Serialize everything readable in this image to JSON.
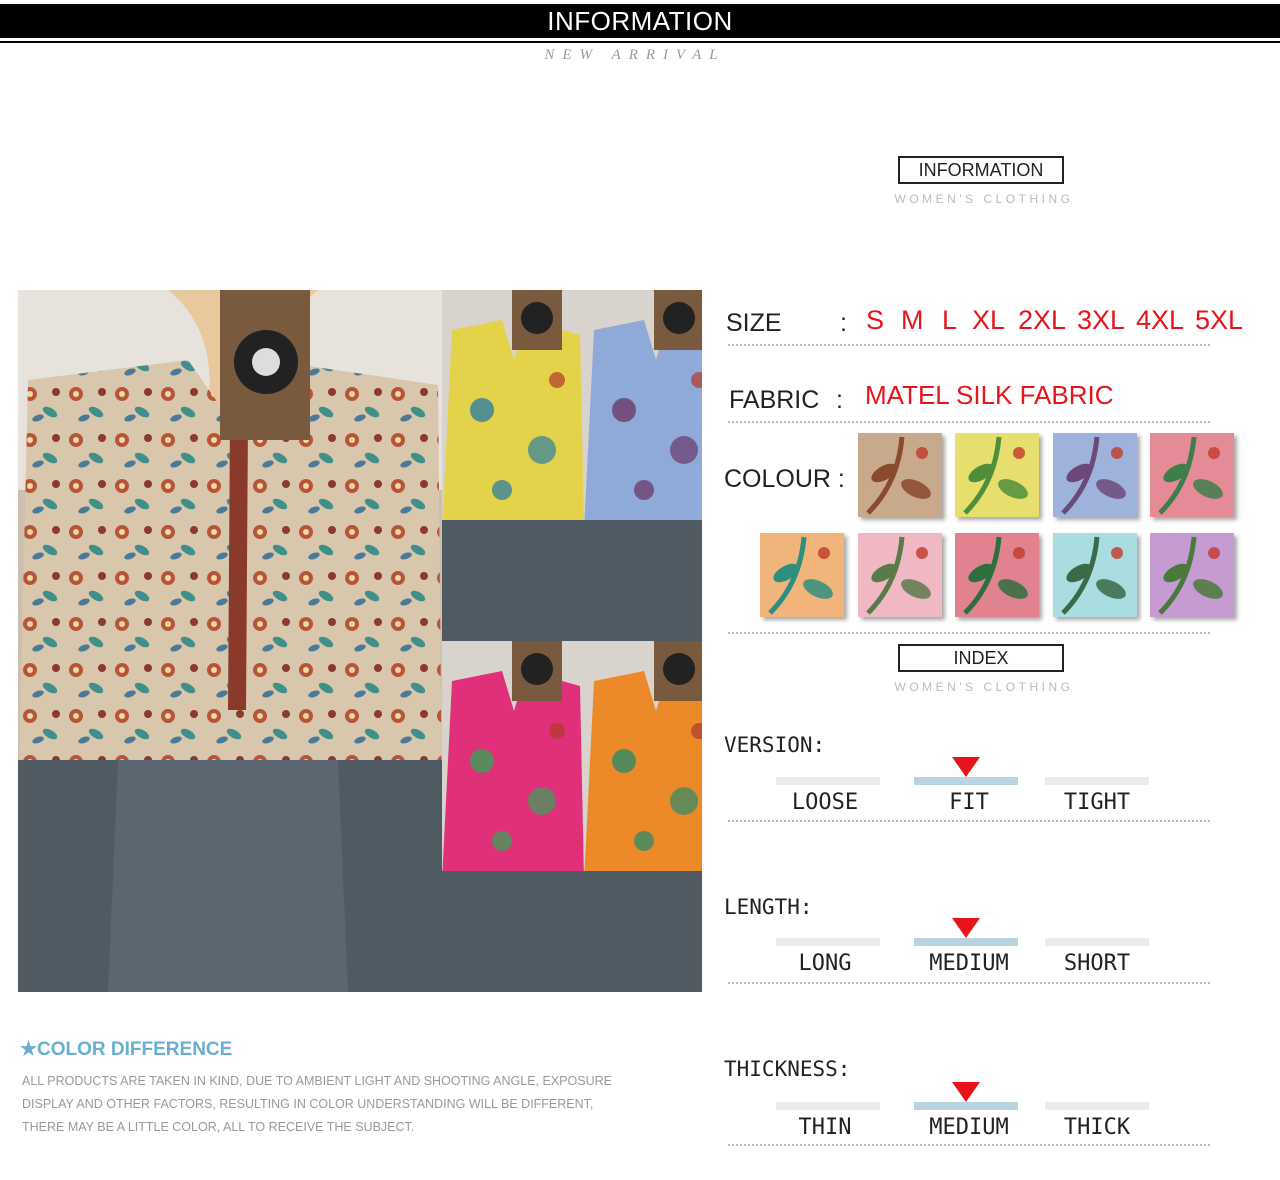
{
  "banner": {
    "title": "INFORMATION",
    "subtitle": "NEW ARRIVAL"
  },
  "info_header": {
    "title": "INFORMATION",
    "subtitle": "WOMEN'S CLOTHING"
  },
  "index_header": {
    "title": "INDEX",
    "subtitle": "WOMEN'S CLOTHING"
  },
  "specs": {
    "size": {
      "label": "SIZE",
      "colon": ":",
      "values": [
        "S",
        "M",
        "L",
        "XL",
        "2XL",
        "3XL",
        "4XL",
        "5XL"
      ]
    },
    "fabric": {
      "label": "FABRIC",
      "colon": ":",
      "value": "MATEL SILK FABRIC"
    },
    "colour": {
      "label": "COLOUR :",
      "swatches": [
        {
          "bg": "#c8a98c",
          "accent": "#8a4a2e"
        },
        {
          "bg": "#e6df6e",
          "accent": "#4f8f3a"
        },
        {
          "bg": "#9fb2dc",
          "accent": "#6b4a7a"
        },
        {
          "bg": "#e58a97",
          "accent": "#3e7e4a"
        },
        {
          "bg": "#f1b47a",
          "accent": "#2f8f7f"
        },
        {
          "bg": "#f0b8c2",
          "accent": "#5a7a4a"
        },
        {
          "bg": "#e0828f",
          "accent": "#2f6f3f"
        },
        {
          "bg": "#a9dde0",
          "accent": "#3a6a4a"
        },
        {
          "bg": "#c59bd2",
          "accent": "#4a7a3a"
        }
      ]
    }
  },
  "index": {
    "version": {
      "label": "VERSION:",
      "options": [
        "LOOSE",
        "FIT",
        "TIGHT"
      ],
      "selected": 1
    },
    "length": {
      "label": "LENGTH:",
      "options": [
        "LONG",
        "MEDIUM",
        "SHORT"
      ],
      "selected": 1
    },
    "thickness": {
      "label": "THICKNESS:",
      "options": [
        "THIN",
        "MEDIUM",
        "THICK"
      ],
      "selected": 1
    }
  },
  "color_difference": {
    "title": "★COLOR DIFFERENCE",
    "lines": [
      "ALL PRODUCTS ARE TAKEN IN KIND, DUE TO AMBIENT LIGHT AND SHOOTING ANGLE, EXPOSURE",
      "DISPLAY AND OTHER FACTORS, RESULTING IN COLOR UNDERSTANDING WILL BE DIFFERENT,",
      "THERE MAY BE A LITTLE COLOR, ALL TO RECEIVE THE SUBJECT."
    ]
  },
  "colors": {
    "accent_red": "#e8141b",
    "index_bar": "#b9d4df",
    "color_diff_blue": "#6aaed0"
  },
  "photo": {
    "main": {
      "bg": "#d9c7ad",
      "pattern": "#9b4a32",
      "jeans": "#4f5a63"
    },
    "variants": [
      {
        "shirt": "#e3d24a",
        "pattern": "#2f7fa0",
        "jeans": "#4f5a63"
      },
      {
        "shirt": "#8fa9d9",
        "pattern": "#6a3a6a",
        "jeans": "#4f5a63"
      },
      {
        "shirt": "#e0307a",
        "pattern": "#3aa05a",
        "jeans": "#4f5a63"
      },
      {
        "shirt": "#ec8a2a",
        "pattern": "#2f8a6a",
        "jeans": "#4f5a63"
      }
    ]
  }
}
